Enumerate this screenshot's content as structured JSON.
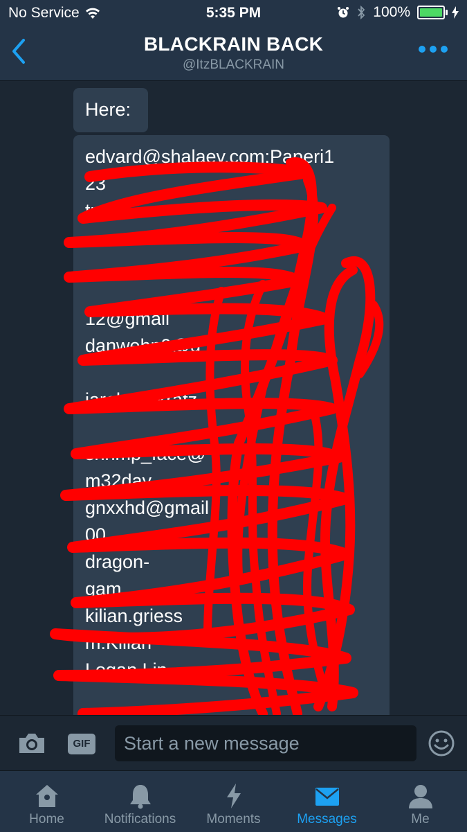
{
  "status": {
    "carrier": "No Service",
    "time": "5:35 PM",
    "battery": "100%",
    "battery_level": 1.0
  },
  "header": {
    "title": "BLACKRAIN BACK",
    "handle": "@ItzBLACKRAIN"
  },
  "messages": [
    {
      "text": "Here:"
    },
    {
      "lines": [
        "edvard@shalaev.com:Paperi1",
        "23",
        "tp3",
        "",
        "",
        "",
        "12@gmail",
        "danwehn9@g",
        "",
        "jarekpankratz",
        "",
        "shrimp_face@",
        "m32day",
        "gnxxhd@gmail",
        "00",
        "dragon-",
        "gam",
        "kilian.griess",
        "m:Kilian",
        "Logan.Lin",
        ""
      ]
    }
  ],
  "composer": {
    "placeholder": "Start a new message",
    "gif_label": "GIF"
  },
  "tabs": [
    {
      "label": "Home",
      "icon": "home-icon",
      "active": false
    },
    {
      "label": "Notifications",
      "icon": "bell-icon",
      "active": false
    },
    {
      "label": "Moments",
      "icon": "lightning-icon",
      "active": false
    },
    {
      "label": "Messages",
      "icon": "envelope-icon",
      "active": true
    },
    {
      "label": "Me",
      "icon": "person-icon",
      "active": false
    }
  ],
  "colors": {
    "background": "#1c2733",
    "bar": "#243447",
    "accent": "#1da1f2",
    "bubble": "#2f3f50",
    "redaction": "#ff0000"
  }
}
